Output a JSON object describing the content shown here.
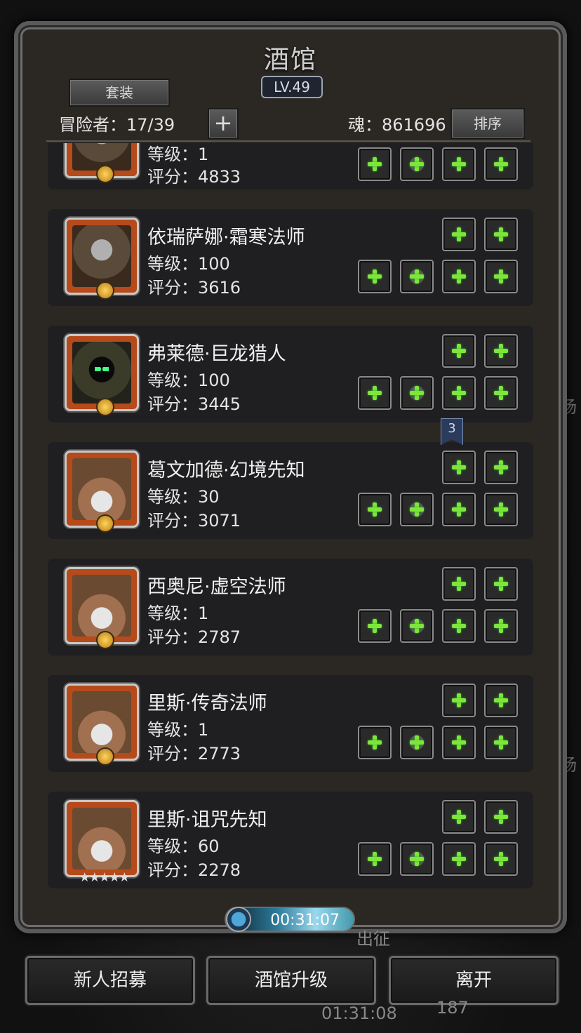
{
  "title": "酒馆",
  "level": "LV.49",
  "header": {
    "outfit_label": "套装",
    "adventurer_label": "冒险者：17/39",
    "add_label": "+",
    "soul_label": "魂：861696",
    "sort_label": "排序"
  },
  "heroes": [
    {
      "name": "",
      "level": "等级：1",
      "score": "评分：4833"
    },
    {
      "name": "依瑞萨娜·霜寒法师",
      "level": "等级：100",
      "score": "评分：3616"
    },
    {
      "name": "弗莱德·巨龙猎人",
      "level": "等级：100",
      "score": "评分：3445"
    },
    {
      "name": "葛文加德·幻境先知",
      "level": "等级：30",
      "score": "评分：3071"
    },
    {
      "name": "西奥尼·虚空法师",
      "level": "等级：1",
      "score": "评分：2787"
    },
    {
      "name": "里斯·传奇法师",
      "level": "等级：1",
      "score": "评分：2773"
    },
    {
      "name": "里斯·诅咒先知",
      "level": "等级：60",
      "score": "评分：2278"
    }
  ],
  "notification_badge": "3",
  "timer": "00:31:07",
  "bottom_buttons": {
    "recruit": "新人招募",
    "upgrade": "酒馆升级",
    "leave": "离开"
  },
  "background": {
    "timer": "01:31:08",
    "count": "187",
    "side_char": "场",
    "expedition": "出征"
  },
  "stars": "★★★★★"
}
